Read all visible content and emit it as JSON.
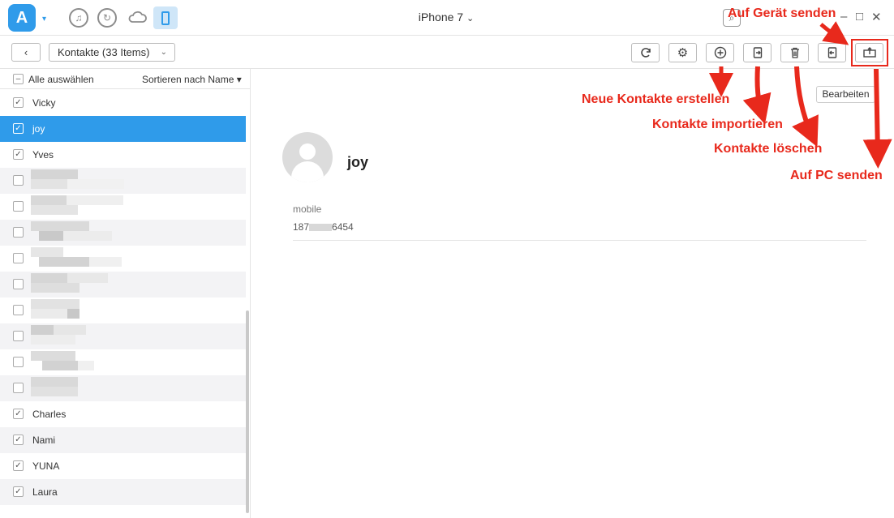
{
  "titlebar": {
    "device_title": "iPhone 7",
    "caret": "⌄",
    "minimize": "–",
    "maximize": "□",
    "close": "✕"
  },
  "toolbar": {
    "back_label": "‹",
    "category_label": "Kontakte (33 Items)",
    "category_caret": "⌄"
  },
  "list": {
    "select_all_label": "Alle auswählen",
    "sort_label": "Sortieren nach Name",
    "sort_caret": "▾",
    "contacts": [
      "Vicky",
      "joy",
      "Yves",
      "",
      "",
      "",
      "",
      "",
      "",
      "",
      "",
      "",
      "Charles",
      "Nami",
      "YUNA",
      "Laura"
    ],
    "selected_index": 1
  },
  "detail": {
    "name": "joy",
    "edit_label": "Bearbeiten",
    "field_label": "mobile",
    "field_value_prefix": "187",
    "field_value_suffix": "6454"
  },
  "annotations": {
    "send_device": "Auf Gerät senden",
    "new_contacts": "Neue Kontakte erstellen",
    "import_contacts": "Kontakte importieren",
    "delete_contacts": "Kontakte löschen",
    "send_pc": "Auf PC senden"
  },
  "colors": {
    "accent": "#2f9bea",
    "annotation": "#e8291c",
    "selected_row": "#2f9bea"
  },
  "icons": [
    "app-logo-icon",
    "music-icon",
    "history-icon",
    "cloud-icon",
    "phone-icon",
    "search-icon",
    "refresh-icon",
    "settings-icon",
    "add-icon",
    "import-icon",
    "delete-icon",
    "send-to-device-icon",
    "send-to-pc-icon"
  ]
}
